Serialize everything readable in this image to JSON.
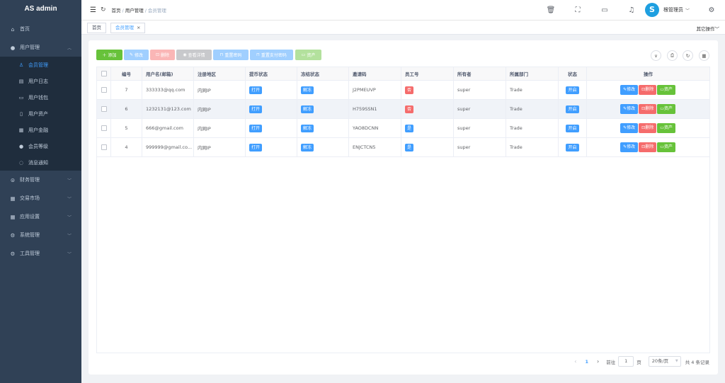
{
  "app": {
    "title": "AS admin"
  },
  "sidebar": {
    "items": [
      {
        "label": "首页",
        "icon": "home-icon"
      },
      {
        "label": "用户管理",
        "icon": "user-icon",
        "expanded": true,
        "children": [
          {
            "label": "会员管理",
            "icon": "user-outline-icon",
            "active": true
          },
          {
            "label": "用户日志",
            "icon": "document-icon"
          },
          {
            "label": "用户钱包",
            "icon": "folder-icon"
          },
          {
            "label": "用户资产",
            "icon": "file-icon"
          },
          {
            "label": "用户金融",
            "icon": "grid-icon"
          },
          {
            "label": "会员等级",
            "icon": "user-icon"
          },
          {
            "label": "消息通知",
            "icon": "chat-icon"
          }
        ]
      },
      {
        "label": "财务管理",
        "icon": "database-icon"
      },
      {
        "label": "交易市场",
        "icon": "grid-icon"
      },
      {
        "label": "应用设置",
        "icon": "grid-icon"
      },
      {
        "label": "系统管理",
        "icon": "gear-icon"
      },
      {
        "label": "工具管理",
        "icon": "gear-icon"
      }
    ]
  },
  "header": {
    "breadcrumb": [
      "首页",
      "用户管理",
      "会员管理"
    ],
    "username": "根管理员",
    "avatar_letter": "S"
  },
  "tags": {
    "items": [
      {
        "label": "首页"
      },
      {
        "label": "会员管理",
        "active": true,
        "close": "×"
      }
    ],
    "other_ops": "其它操作"
  },
  "toolbar": {
    "add": "添加",
    "edit": "修改",
    "delete": "删除",
    "view": "查看详情",
    "reset_pwd": "重置密码",
    "reset_pay_pwd": "重置支付密码",
    "assets": "资产"
  },
  "table": {
    "columns": [
      "编号",
      "用户名(邮箱)",
      "注册地区",
      "提币状态",
      "冻结状态",
      "邀请码",
      "员工号",
      "所有者",
      "所属部门",
      "状态",
      "操作"
    ],
    "rows": [
      {
        "id": "7",
        "username": "333333@qq.com",
        "region": "内网IP",
        "withdraw": "打开",
        "freeze": "解冻",
        "invite": "J2PMEUVP",
        "staff": "否",
        "staff_color": "#f56c6c",
        "owner": "super",
        "dept": "Trade",
        "status": "开启"
      },
      {
        "id": "6",
        "username": "1232131@123.com",
        "region": "内网IP",
        "withdraw": "打开",
        "freeze": "解冻",
        "invite": "H759SSN1",
        "staff": "否",
        "staff_color": "#f56c6c",
        "owner": "super",
        "dept": "Trade",
        "status": "开启"
      },
      {
        "id": "5",
        "username": "666@gmail.com",
        "region": "内网IP",
        "withdraw": "打开",
        "freeze": "解冻",
        "invite": "YAO8DCNN",
        "staff": "是",
        "staff_color": "#409eff",
        "owner": "super",
        "dept": "Trade",
        "status": "开启"
      },
      {
        "id": "4",
        "username": "999999@gmail.co...",
        "region": "内网IP",
        "withdraw": "打开",
        "freeze": "解冻",
        "invite": "ENJCTCN5",
        "staff": "是",
        "staff_color": "#409eff",
        "owner": "super",
        "dept": "Trade",
        "status": "开启"
      }
    ],
    "row_actions": {
      "edit": "修改",
      "delete": "删除",
      "assets": "资产"
    }
  },
  "pagination": {
    "current": "1",
    "goto_label": "前往",
    "goto_value": "1",
    "page_unit": "页",
    "page_size": "20条/页",
    "total": "共 4 条记录"
  },
  "colors": {
    "sidebar_bg": "#304156",
    "primary": "#409eff",
    "success": "#67c23a",
    "danger": "#f56c6c",
    "info": "#909399"
  }
}
